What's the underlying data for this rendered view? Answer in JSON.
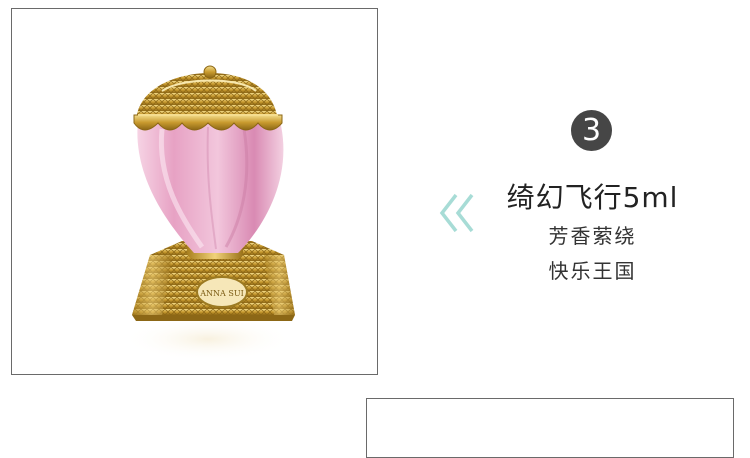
{
  "step": {
    "number": "3"
  },
  "product": {
    "title": "绮幻飞行5ml",
    "line1": "芳香萦绕",
    "line2": "快乐王国",
    "brand_on_label": "ANNA SUI"
  },
  "colors": {
    "badge": "#464646",
    "chevron": "#a7dcd6",
    "gold": "#c9a23a",
    "pink_glass": "#e9a9c8"
  },
  "icons": {
    "chevron": "double-chevron-left-icon"
  }
}
